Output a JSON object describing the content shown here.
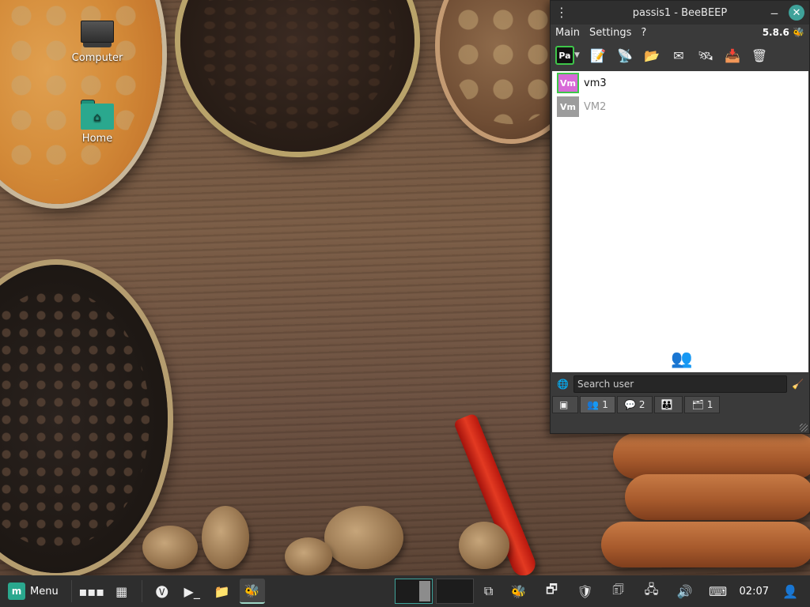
{
  "desktop": {
    "icons": [
      {
        "label": "Computer",
        "icon": "computer-icon"
      },
      {
        "label": "Home",
        "icon": "home-folder-icon"
      }
    ]
  },
  "window": {
    "title": "passis1 - BeeBEEP",
    "menu": [
      "Main",
      "Settings",
      "?"
    ],
    "version": "5.8.6",
    "status_badge": "Pa",
    "toolbar_icons": [
      "status-icon",
      "edit-profile-icon",
      "broadcast-icon",
      "folder-icon",
      "write-message-icon",
      "network-icon",
      "download-icon",
      "trash-icon"
    ],
    "users": [
      {
        "badge": "Vm",
        "name": "vm3",
        "status": "online"
      },
      {
        "badge": "Vm",
        "name": "VM2",
        "status": "offline"
      }
    ],
    "search_placeholder": "Search user",
    "tabs": [
      {
        "icon": "status-tab-icon",
        "count": ""
      },
      {
        "icon": "users-tab-icon",
        "count": "1"
      },
      {
        "icon": "chats-tab-icon",
        "count": "2"
      },
      {
        "icon": "groups-tab-icon",
        "count": ""
      },
      {
        "icon": "files-tab-icon",
        "count": "1"
      }
    ]
  },
  "taskbar": {
    "menu_label": "Menu",
    "clock": "02:07"
  },
  "colors": {
    "accent": "#3fa29a",
    "online": "#3ec64a",
    "user_badge": "#d86ad8"
  }
}
